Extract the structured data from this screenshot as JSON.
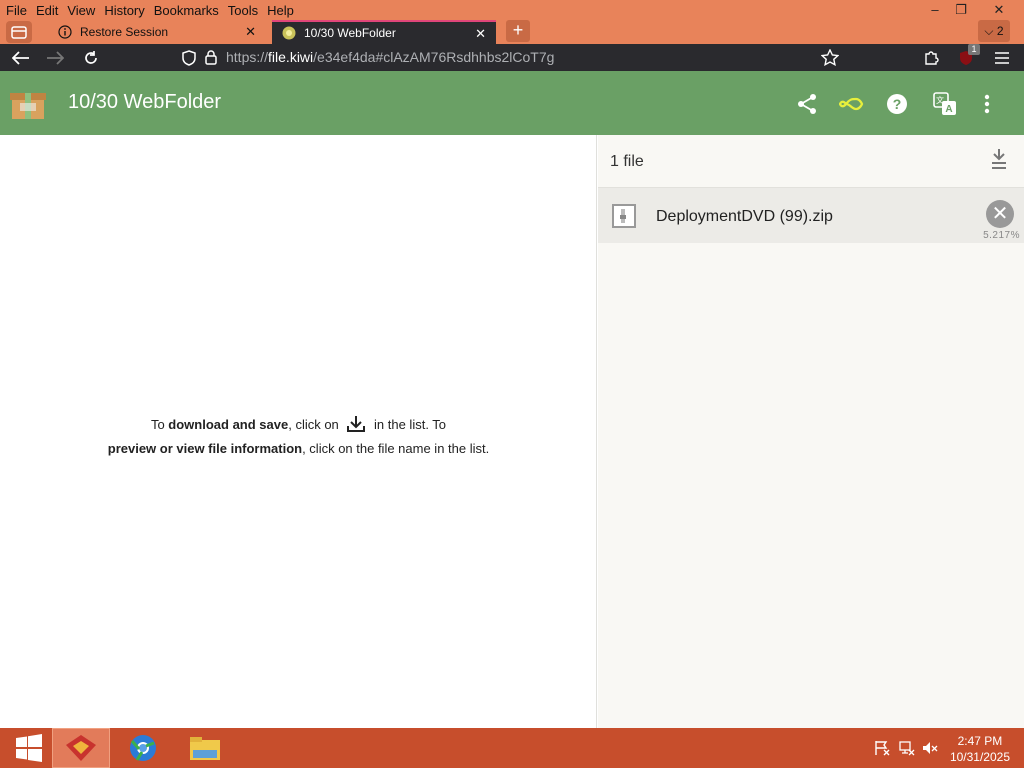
{
  "menu": [
    "File",
    "Edit",
    "View",
    "History",
    "Bookmarks",
    "Tools",
    "Help"
  ],
  "window_controls": {
    "minimize": "–",
    "restore": "❐",
    "close": "✕"
  },
  "tabs": [
    {
      "label": "Restore Session",
      "close": "✕"
    },
    {
      "label": "10/30 WebFolder",
      "close": "✕"
    }
  ],
  "new_tab": "+",
  "all_tabs": "2",
  "address": {
    "prefix": "https://",
    "host": "file.kiwi",
    "path": "/e34ef4da#clAzAM76Rsdhhbs2lCoT7g"
  },
  "extension_badge": "1",
  "app": {
    "title": "10/30 WebFolder"
  },
  "help": {
    "p1a": "To ",
    "p1b": "download and save",
    "p1c": ", click on ",
    "p1d": " in the list. To",
    "p2a": "preview or view file information",
    "p2b": ", click on the file name in the list."
  },
  "files_panel": {
    "count": "1 file",
    "files": [
      {
        "name": "DeploymentDVD (99).zip",
        "progress_label": "5.217%",
        "progress": 5.217
      }
    ]
  },
  "taskbar": {
    "time": "2:47 PM",
    "date": "10/31/2025"
  },
  "colors": {
    "appbar": "#6aa065",
    "titlebar": "#e8835a",
    "taskbar": "#c74e2c",
    "active_tab_accent": "#e0467a"
  }
}
